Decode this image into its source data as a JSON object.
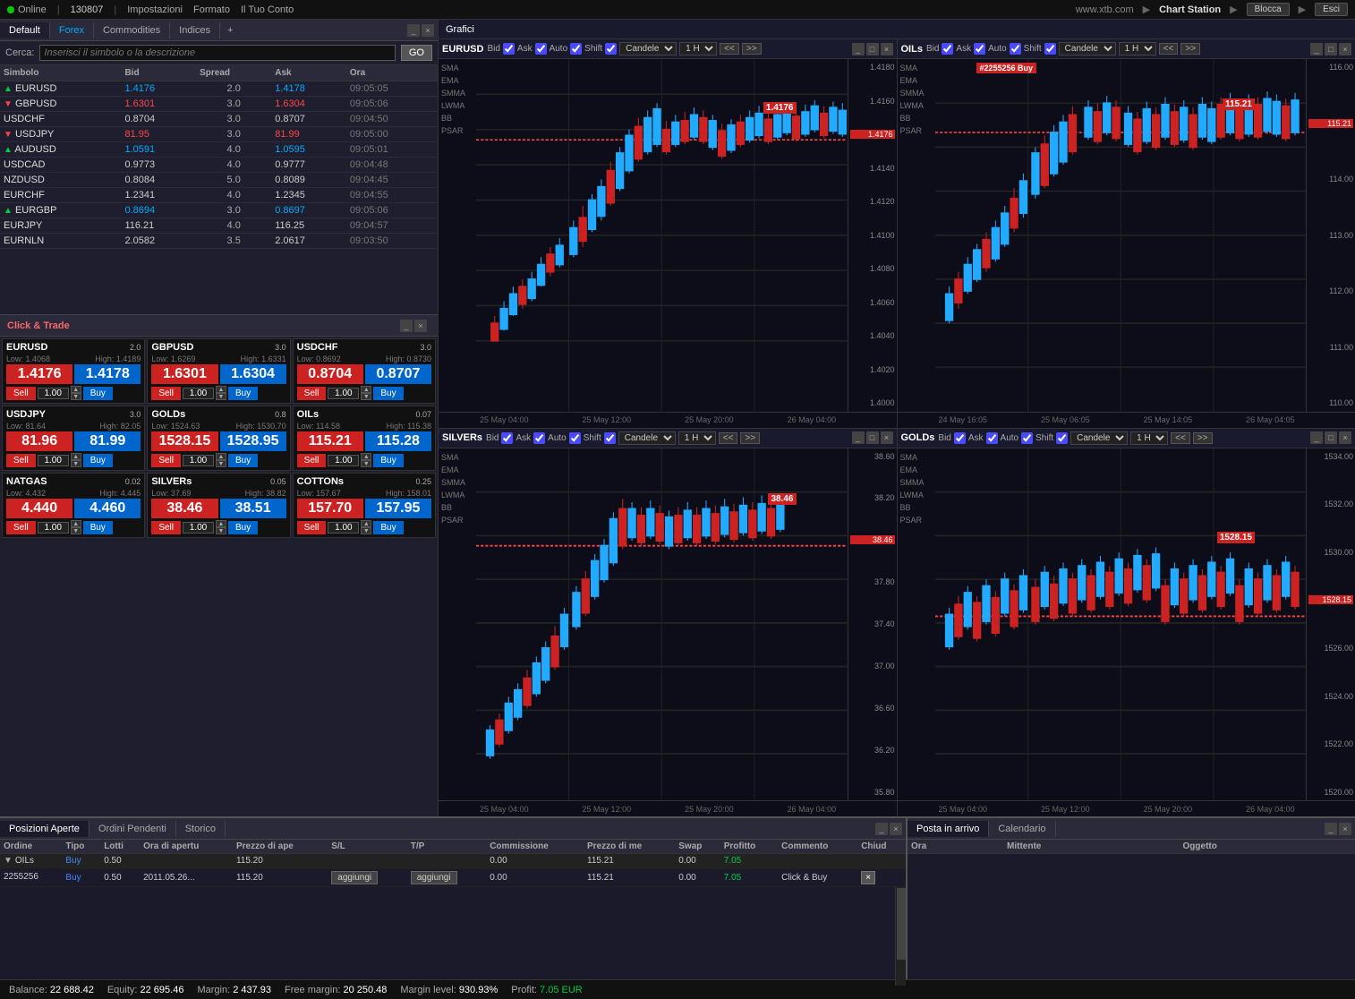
{
  "topbar": {
    "online_label": "Online",
    "user_id": "130807",
    "settings_label": "Impostazioni",
    "format_label": "Formato",
    "account_label": "Il Tuo Conto",
    "website": "www.xtb.com",
    "chart_station": "Chart Station",
    "blocca_label": "Blocca",
    "esci_label": "Esci"
  },
  "watchlist": {
    "tabs": [
      "Default",
      "Forex",
      "Commodities",
      "Indices"
    ],
    "search_placeholder": "Inserisci il simbolo o la descrizione",
    "go_label": "GO",
    "columns": [
      "Simbolo",
      "Bid",
      "Spread",
      "Ask",
      "Ora"
    ],
    "rows": [
      {
        "symbol": "EURUSD",
        "bid": "1.4176",
        "spread": "2.0",
        "ask": "1.4178",
        "time": "09:05:05",
        "direction": "up",
        "ask_color": "up"
      },
      {
        "symbol": "GBPUSD",
        "bid": "1.6301",
        "spread": "3.0",
        "ask": "1.6304",
        "time": "09:05:06",
        "direction": "down",
        "ask_color": "down"
      },
      {
        "symbol": "USDCHF",
        "bid": "0.8704",
        "spread": "3.0",
        "ask": "0.8707",
        "time": "09:04:50",
        "direction": "none",
        "ask_color": "normal"
      },
      {
        "symbol": "USDJPY",
        "bid": "81.95",
        "spread": "3.0",
        "ask": "81.99",
        "time": "09:05:00",
        "direction": "down",
        "ask_color": "down"
      },
      {
        "symbol": "AUDUSD",
        "bid": "1.0591",
        "spread": "4.0",
        "ask": "1.0595",
        "time": "09:05:01",
        "direction": "up",
        "ask_color": "up"
      },
      {
        "symbol": "USDCAD",
        "bid": "0.9773",
        "spread": "4.0",
        "ask": "0.9777",
        "time": "09:04:48",
        "direction": "none",
        "ask_color": "normal"
      },
      {
        "symbol": "NZDUSD",
        "bid": "0.8084",
        "spread": "5.0",
        "ask": "0.8089",
        "time": "09:04:45",
        "direction": "none",
        "ask_color": "normal"
      },
      {
        "symbol": "EURCHF",
        "bid": "1.2341",
        "spread": "4.0",
        "ask": "1.2345",
        "time": "09:04:55",
        "direction": "none",
        "ask_color": "normal"
      },
      {
        "symbol": "EURGBP",
        "bid": "0.8694",
        "spread": "3.0",
        "ask": "0.8697",
        "time": "09:05:06",
        "direction": "up",
        "ask_color": "up"
      },
      {
        "symbol": "EURJPY",
        "bid": "116.21",
        "spread": "4.0",
        "ask": "116.25",
        "time": "09:04:57",
        "direction": "none",
        "ask_color": "normal"
      },
      {
        "symbol": "EURNLN",
        "bid": "2.0582",
        "spread": "3.5",
        "ask": "2.0617",
        "time": "09:03:50",
        "direction": "none",
        "ask_color": "normal"
      }
    ]
  },
  "click_trade": {
    "title": "Click & Trade",
    "cards": [
      {
        "symbol": "EURUSD",
        "spread": "2.0",
        "low": "1.4068",
        "high": "1.4189",
        "sell": "1.4176",
        "buy": "1.4178",
        "qty": "1.00"
      },
      {
        "symbol": "GBPUSD",
        "spread": "3.0",
        "low": "1.6269",
        "high": "1.6331",
        "sell": "1.6301",
        "buy": "1.6304",
        "qty": "1.00"
      },
      {
        "symbol": "USDCHF",
        "spread": "3.0",
        "low": "0.8692",
        "high": "0.8730",
        "sell": "0.8704",
        "buy": "0.8707",
        "qty": "1.00"
      },
      {
        "symbol": "USDJPY",
        "spread": "3.0",
        "low": "81.64",
        "high": "82.05",
        "sell": "81.96",
        "buy": "81.99",
        "qty": "1.00"
      },
      {
        "symbol": "GOLDs",
        "spread": "0.8",
        "low": "1524.63",
        "high": "1530.70",
        "sell": "1528.15",
        "buy": "1528.95",
        "qty": "1.00"
      },
      {
        "symbol": "OILs",
        "spread": "0.07",
        "low": "114.58",
        "high": "115.38",
        "sell": "115.21",
        "buy": "115.28",
        "qty": "1.00"
      },
      {
        "symbol": "NATGAS",
        "spread": "0.02",
        "low": "4.432",
        "high": "4.445",
        "sell": "4.440",
        "buy": "4.460",
        "qty": "1.00"
      },
      {
        "symbol": "SILVERs",
        "spread": "0.05",
        "low": "37.69",
        "high": "38.82",
        "sell": "38.46",
        "buy": "38.51",
        "qty": "1.00"
      },
      {
        "symbol": "COTTONs",
        "spread": "0.25",
        "low": "157.67",
        "high": "158.01",
        "sell": "157.70",
        "buy": "157.95",
        "qty": "1.00"
      }
    ]
  },
  "charts": {
    "grafici_label": "Grafici",
    "chart1": {
      "symbol": "EURUSD",
      "bid_checked": true,
      "ask_checked": true,
      "auto_checked": true,
      "shift_checked": true,
      "type": "Candele",
      "timeframe": "1 H",
      "current_price": "1.4176",
      "indicators": [
        "SMA",
        "EMA",
        "SMMA",
        "LWMA",
        "BB",
        "PSAR"
      ],
      "price_levels": [
        "1.4180",
        "1.4160",
        "1.4140",
        "1.4120",
        "1.4100",
        "1.4080",
        "1.4060",
        "1.4040",
        "1.4020",
        "1.4000"
      ],
      "time_labels": [
        "25 May 04:00",
        "25 May 12:00",
        "25 May 20:00",
        "26 May 04:00"
      ]
    },
    "chart2": {
      "symbol": "OILs",
      "current_price": "115.21",
      "overlay_label": "#2255256 Buy",
      "type": "Candele",
      "timeframe": "1 H",
      "indicators": [
        "SMA",
        "EMA",
        "SMMA",
        "LWMA",
        "BB",
        "PSAR"
      ],
      "price_levels": [
        "116.00",
        "115.21",
        "114.00",
        "113.00",
        "112.00",
        "111.00",
        "110.00"
      ],
      "time_labels": [
        "24 May 16:05",
        "25 May 06:05",
        "25 May 14:05",
        "26 May 04:05"
      ]
    },
    "chart3": {
      "symbol": "SILVERs",
      "current_price": "38.46",
      "type": "Candele",
      "timeframe": "1 H",
      "indicators": [
        "SMA",
        "EMA",
        "SMMA",
        "LWMA",
        "BB",
        "PSAR"
      ],
      "price_levels": [
        "38.60",
        "38.20",
        "37.80",
        "37.40",
        "37.00",
        "36.60",
        "36.20",
        "35.80"
      ],
      "time_labels": [
        "25 May 04:00",
        "25 May 12:00",
        "25 May 20:00",
        "26 May 04:00"
      ]
    },
    "chart4": {
      "symbol": "GOLDs",
      "current_price": "1528.15",
      "type": "Candele",
      "timeframe": "1 H",
      "indicators": [
        "SMA",
        "EMA",
        "SMMA",
        "LWMA",
        "BB",
        "PSAR"
      ],
      "price_levels": [
        "1534.00",
        "1532.00",
        "1530.00",
        "1528.15",
        "1526.00",
        "1524.00",
        "1522.00",
        "1520.00"
      ],
      "time_labels": [
        "25 May 04:00",
        "25 May 12:00",
        "25 May 20:00",
        "26 May 04:00"
      ]
    }
  },
  "positions": {
    "tabs": [
      "Posizioni Aperte",
      "Ordini Pendenti",
      "Storico"
    ],
    "right_tabs": [
      "Posta in arrivo",
      "Calendario"
    ],
    "columns": [
      "Ordine",
      "Tipo",
      "Lotti",
      "Ora di apertu",
      "Prezzo di ape",
      "S/L",
      "T/P",
      "Commissione",
      "Prezzo di me",
      "Swap",
      "Profitto",
      "Commento",
      "Chiu"
    ],
    "right_columns": [
      "Ora",
      "Mittente",
      "Oggetto"
    ],
    "group_symbol": "OILs",
    "group_type": "Buy",
    "group_lotti": "0.50",
    "group_price": "115.20",
    "group_commission": "0.00",
    "group_current": "115.21",
    "group_swap": "0.00",
    "group_profit": "7.05",
    "order_id": "2255256",
    "order_type": "Buy",
    "order_lotti": "0.50",
    "order_date": "2011.05.26...",
    "order_price": "115.20",
    "order_sl": "",
    "order_tp": "",
    "order_commission": "0.00",
    "order_current": "115.21",
    "order_swap": "0.00",
    "order_profit": "7.05",
    "order_comment": "Click & Buy",
    "add_btn1": "aggiungi",
    "add_btn2": "aggiungi"
  },
  "statusbar": {
    "balance_label": "Balance:",
    "balance_value": "22 688.42",
    "equity_label": "Equity:",
    "equity_value": "22 695.46",
    "margin_label": "Margin:",
    "margin_value": "2 437.93",
    "free_margin_label": "Free margin:",
    "free_margin_value": "20 250.48",
    "margin_level_label": "Margin level:",
    "margin_level_value": "930.93%",
    "profit_label": "Profit:",
    "profit_value": "7.05",
    "currency": "EUR"
  }
}
